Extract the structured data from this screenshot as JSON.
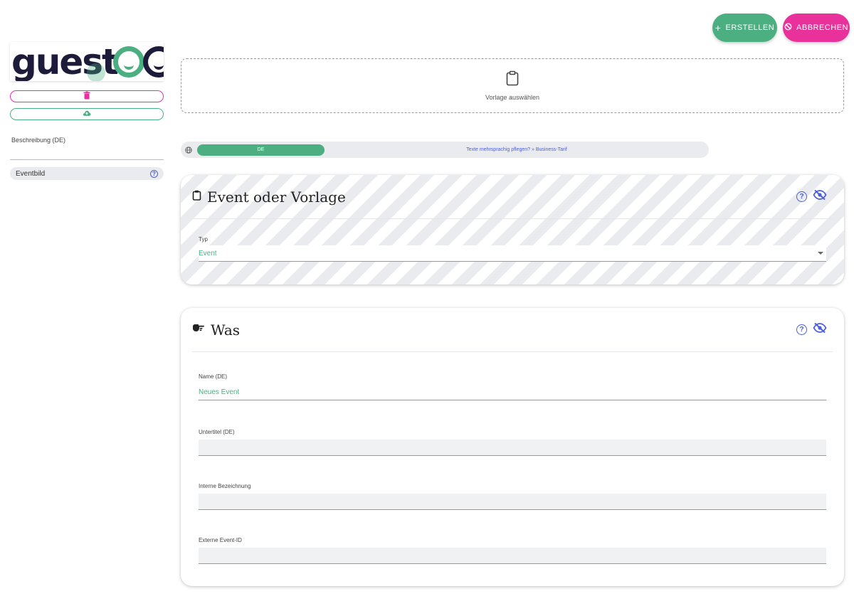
{
  "header": {
    "create_label": "ERSTELLEN",
    "cancel_label": "ABBRECHEN"
  },
  "sidebar": {
    "logo_text": "guest",
    "description_label": "Beschreibung (DE)",
    "eventbild_label": "Eventbild"
  },
  "template": {
    "label": "Vorlage auswählen"
  },
  "language": {
    "active": "DE",
    "upsell": "Texte mehrsprachig pflegen? » Business-Tarif"
  },
  "card_type": {
    "title": "Event oder Vorlage",
    "type_label": "Typ",
    "type_value": "Event"
  },
  "card_what": {
    "title": "Was",
    "name_label": "Name (DE)",
    "name_value": "Neues Event",
    "subtitle_label": "Untertitel (DE)",
    "subtitle_value": "",
    "internal_label": "Interne Bezeichnung",
    "internal_value": "",
    "external_label": "Externe Event-ID",
    "external_value": ""
  },
  "help_symbol": "?",
  "colors": {
    "green": "#4caf82",
    "pink": "#e8319b",
    "link_blue": "#4a5ee0"
  },
  "icons": [
    "plus-icon",
    "ban-icon",
    "trash-icon",
    "cloud-upload-icon",
    "clipboard-icon",
    "globe-icon",
    "help-icon",
    "eye-off-icon",
    "hand-point-icon",
    "chevron-down-icon"
  ]
}
